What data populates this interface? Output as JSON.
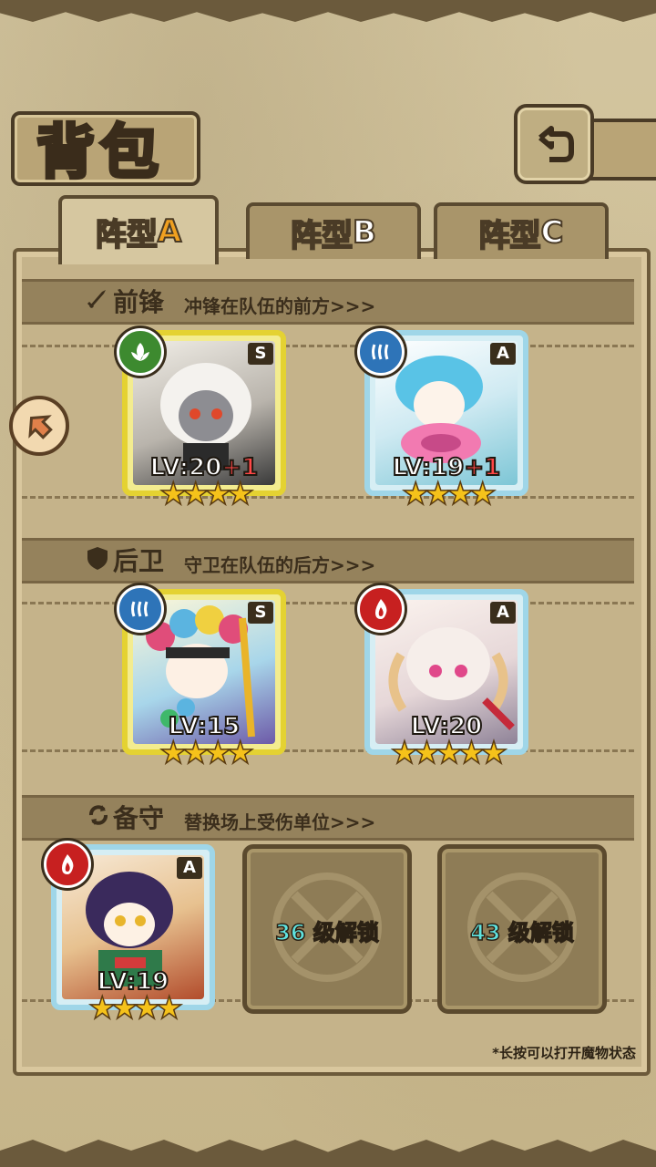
{
  "header": {
    "title": "背包",
    "back_icon": "return-arrow-icon"
  },
  "tabs": [
    {
      "label": "阵型",
      "suffix": "A",
      "active": true
    },
    {
      "label": "阵型",
      "suffix": "B",
      "active": false
    },
    {
      "label": "阵型",
      "suffix": "C",
      "active": false
    }
  ],
  "sections": {
    "front": {
      "title": "前锋",
      "hint": "冲锋在队伍的前方>>>"
    },
    "back": {
      "title": "后卫",
      "hint": "守卫在队伍的后方>>>"
    },
    "reserve": {
      "title": "备守",
      "hint": "替换场上受伤单位>>>"
    }
  },
  "cards": {
    "front1": {
      "rank": "S",
      "element": "nature",
      "level": "LV:20",
      "bonus": "+1",
      "stars": "★★★★"
    },
    "front2": {
      "rank": "A",
      "element": "water",
      "level": "LV:19",
      "bonus": "+1",
      "stars": "★★★★"
    },
    "back1": {
      "rank": "S",
      "element": "water",
      "level": "LV:15",
      "bonus": "",
      "stars": "★★★★"
    },
    "back2": {
      "rank": "A",
      "element": "fire",
      "level": "LV:20",
      "bonus": "",
      "stars": "★★★★★"
    },
    "reserve1": {
      "rank": "A",
      "element": "fire",
      "level": "LV:19",
      "bonus": "",
      "stars": "★★★★"
    }
  },
  "locked_slots": [
    {
      "level": "36",
      "text": " 级解锁"
    },
    {
      "level": "43",
      "text": " 级解锁"
    }
  ],
  "footnote": "*长按可以打开魔物状态",
  "colors": {
    "gold_frame": "#e4d232",
    "blue_frame": "#9fd6e8",
    "unlock_number": "#5fe3e0",
    "bonus": "#ff4747"
  }
}
